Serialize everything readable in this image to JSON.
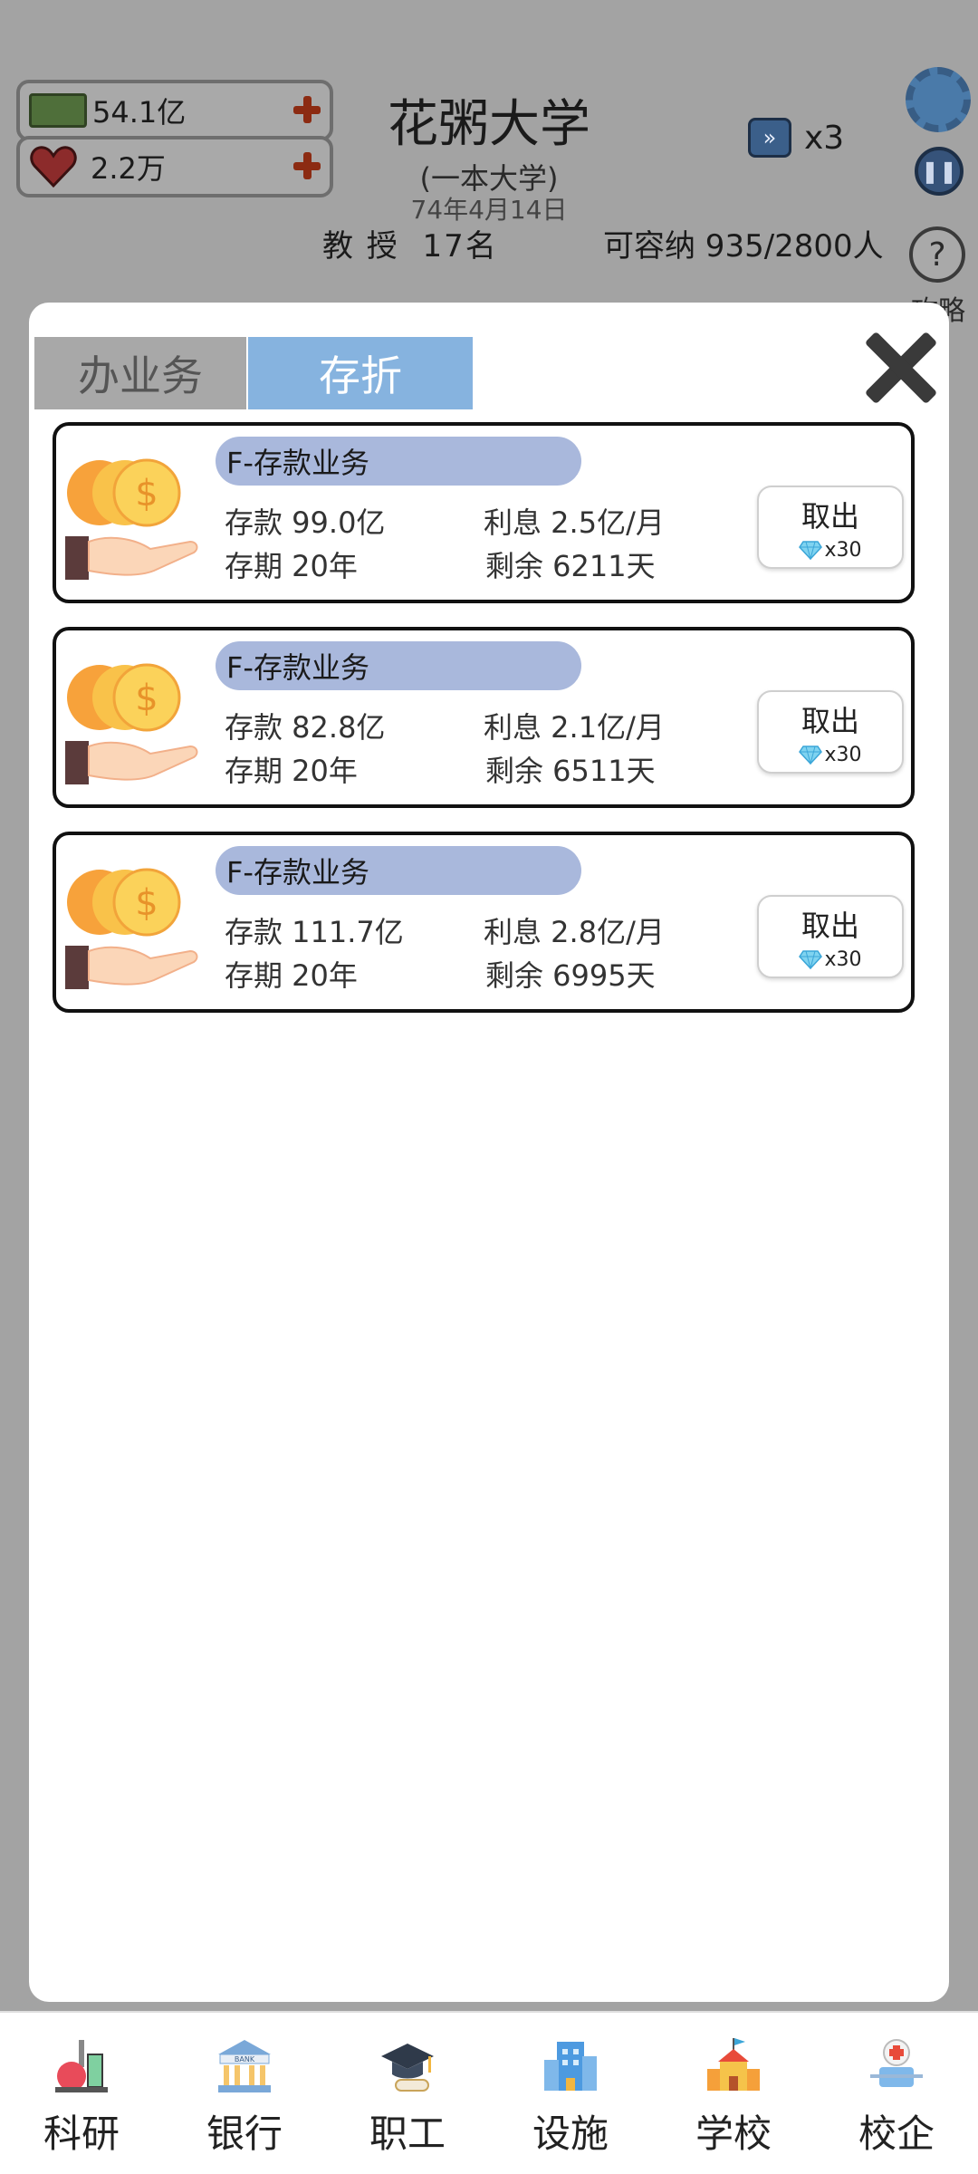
{
  "background": {
    "money": "54.1亿",
    "reputation": "2.2万",
    "school_name": "花粥大学",
    "school_tier": "(一本大学)",
    "date": "74年4月14日",
    "professor_label": "教 授",
    "professor_count": "17名",
    "capacity": "可容纳 935/2800人",
    "speed": "x3",
    "guide_label": "攻略"
  },
  "modal": {
    "tabs": [
      {
        "label": "办业务",
        "active": false
      },
      {
        "label": "存折",
        "active": true
      }
    ],
    "deposits": [
      {
        "tag": "F-存款业务",
        "amount": "存款 99.0亿",
        "term": "存期 20年",
        "interest": "利息 2.5亿/月",
        "remaining": "剩余 6211天",
        "withdraw_label": "取出",
        "withdraw_cost": "x30"
      },
      {
        "tag": "F-存款业务",
        "amount": "存款 82.8亿",
        "term": "存期 20年",
        "interest": "利息 2.1亿/月",
        "remaining": "剩余 6511天",
        "withdraw_label": "取出",
        "withdraw_cost": "x30"
      },
      {
        "tag": "F-存款业务",
        "amount": "存款 111.7亿",
        "term": "存期 20年",
        "interest": "利息 2.8亿/月",
        "remaining": "剩余 6995天",
        "withdraw_label": "取出",
        "withdraw_cost": "x30"
      }
    ]
  },
  "bottom_nav": [
    {
      "label": "科研",
      "icon": "flask-icon"
    },
    {
      "label": "银行",
      "icon": "bank-icon"
    },
    {
      "label": "职工",
      "icon": "graduation-cap-icon"
    },
    {
      "label": "设施",
      "icon": "building-icon"
    },
    {
      "label": "学校",
      "icon": "school-icon"
    },
    {
      "label": "校企",
      "icon": "medical-icon"
    }
  ],
  "colors": {
    "tab_active": "#86b3df",
    "tab_inactive": "#a8a8a8",
    "tag_bg": "#a9b8dc",
    "overlay": "#a3a3a3"
  }
}
